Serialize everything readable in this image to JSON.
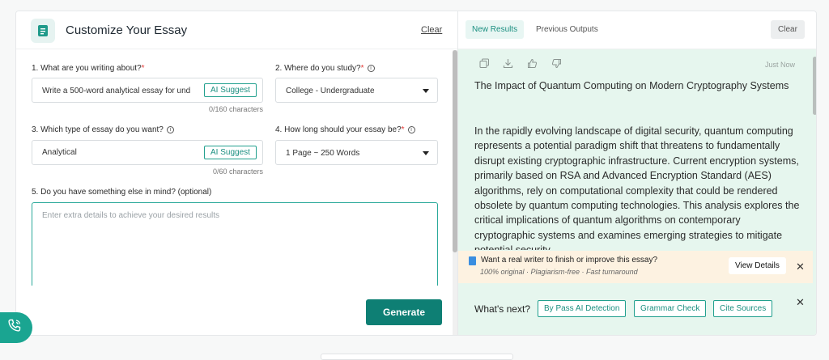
{
  "left": {
    "title": "Customize Your Essay",
    "clear_label": "Clear",
    "q1": {
      "label": "1. What are you writing about?",
      "value": "Write a 500-word analytical essay for und",
      "ai_label": "AI Suggest",
      "counter": "0/160 characters"
    },
    "q2": {
      "label": "2. Where do you study?",
      "value": "College - Undergraduate"
    },
    "q3": {
      "label": "3. Which type of essay do you want?",
      "value": "Analytical",
      "ai_label": "AI Suggest",
      "counter": "0/60 characters"
    },
    "q4": {
      "label": "4. How long should your essay be?",
      "value": "1 Page ~ 250 Words"
    },
    "q5": {
      "label": "5. Do you have something else in mind? (optional)",
      "placeholder": "Enter extra details to achieve your desired results"
    },
    "generate_label": "Generate"
  },
  "right": {
    "tabs": {
      "new": "New Results",
      "previous": "Previous Outputs"
    },
    "clear_label": "Clear",
    "timestamp": "Just Now",
    "essay_title": "The Impact of Quantum Computing on Modern Cryptography Systems",
    "essay_body": "In the rapidly evolving landscape of digital security, quantum computing represents a potential paradigm shift that threatens to fundamentally disrupt existing cryptographic infrastructure. Current encryption systems, primarily based on RSA and Advanced Encryption Standard (AES) algorithms, rely on computational complexity that could be rendered obsolete by quantum computing technologies. This analysis explores the critical implications of quantum algorithms on contemporary cryptographic systems and examines emerging strategies to mitigate potential security",
    "promo": {
      "title": "Want a real writer to finish or improve this essay?",
      "subtitle": "100% original · Plagiarism-free · Fast turnaround",
      "button": "View Details"
    },
    "whats_next": {
      "label": "What's next?",
      "buttons": [
        "By Pass AI Detection",
        "Grammar Check",
        "Cite Sources"
      ]
    }
  },
  "colors": {
    "accent": "#0e7f74",
    "output_bg": "#e6f6ee",
    "promo_bg": "#fdf2e1"
  },
  "icons": [
    "document-icon",
    "copy-icon",
    "download-icon",
    "thumbs-up-icon",
    "thumbs-down-icon",
    "close-icon",
    "phone-icon",
    "info-icon",
    "chevron-down-icon",
    "book-icon"
  ]
}
